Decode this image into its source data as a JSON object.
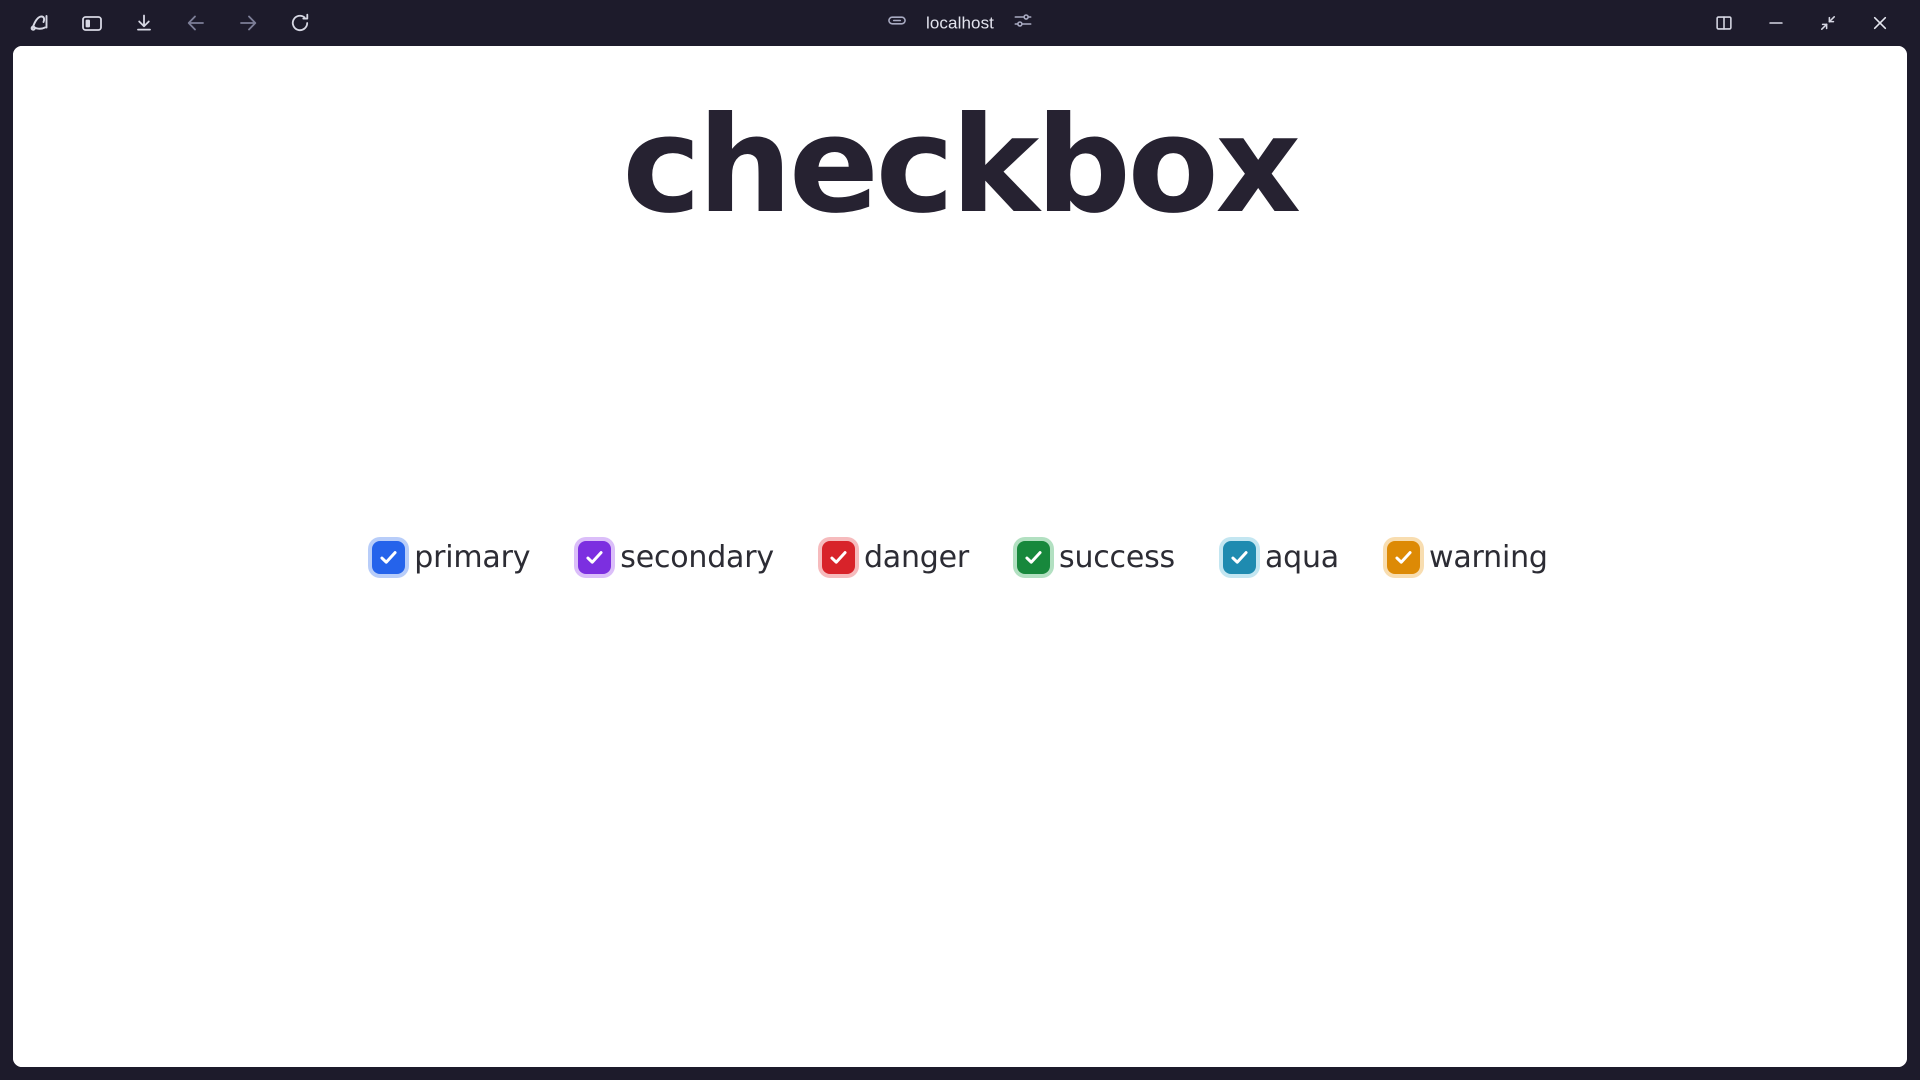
{
  "browser": {
    "url": "localhost",
    "toolbar_left": [
      {
        "name": "arc-logo-icon",
        "label": "Arc",
        "interactable": true
      },
      {
        "name": "toggle-sidebar-icon",
        "label": "Toggle Sidebar",
        "interactable": true
      },
      {
        "name": "downloads-icon",
        "label": "Downloads",
        "interactable": true
      },
      {
        "name": "back-icon",
        "label": "Back",
        "interactable": true
      },
      {
        "name": "forward-icon",
        "label": "Forward",
        "interactable": true
      },
      {
        "name": "reload-icon",
        "label": "Reload",
        "interactable": true
      }
    ],
    "urlbar": [
      {
        "name": "link-icon",
        "label": "Copy Link",
        "interactable": true
      },
      {
        "name": "sliders-icon",
        "label": "Site Settings",
        "interactable": true
      }
    ],
    "toolbar_right": [
      {
        "name": "split-view-icon",
        "label": "Split View",
        "interactable": true
      },
      {
        "name": "minimize-icon",
        "label": "Minimize",
        "interactable": true
      },
      {
        "name": "restore-icon",
        "label": "Restore Down",
        "interactable": true
      },
      {
        "name": "close-icon",
        "label": "Close",
        "interactable": true
      }
    ],
    "colors": {
      "chrome_bg": "#1d1b2b",
      "icon_bright": "#d7d8e4",
      "icon_dim": "#7d7f98",
      "url_text": "#e2e3ee"
    }
  },
  "page": {
    "title": "checkbox",
    "title_color": "#262231",
    "background": "#ffffff",
    "label_color": "#2c2c34",
    "checkboxes": [
      {
        "label": "primary",
        "color": "#2563eb",
        "glow": "#4d83f0",
        "checked": true
      },
      {
        "label": "secondary",
        "color": "#7c2fe0",
        "glow": "#a45cf0",
        "checked": true
      },
      {
        "label": "danger",
        "color": "#d8232a",
        "glow": "#e8545a",
        "checked": true
      },
      {
        "label": "success",
        "color": "#17883c",
        "glow": "#3fb264",
        "checked": true
      },
      {
        "label": "aqua",
        "color": "#1f8bb0",
        "glow": "#68c0dc",
        "checked": true
      },
      {
        "label": "warning",
        "color": "#dd8a05",
        "glow": "#eeab3a",
        "checked": true
      }
    ]
  }
}
